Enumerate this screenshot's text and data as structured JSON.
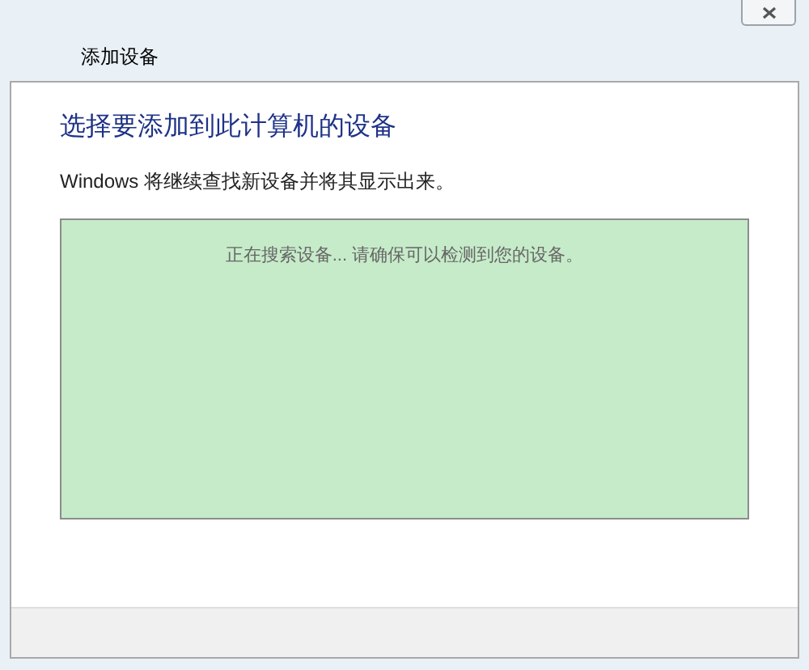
{
  "window": {
    "title": "添加设备"
  },
  "heading": "选择要添加到此计算机的设备",
  "description": "Windows 将继续查找新设备并将其显示出来。",
  "device_list": {
    "status": "正在搜索设备... 请确保可以检测到您的设备。"
  }
}
